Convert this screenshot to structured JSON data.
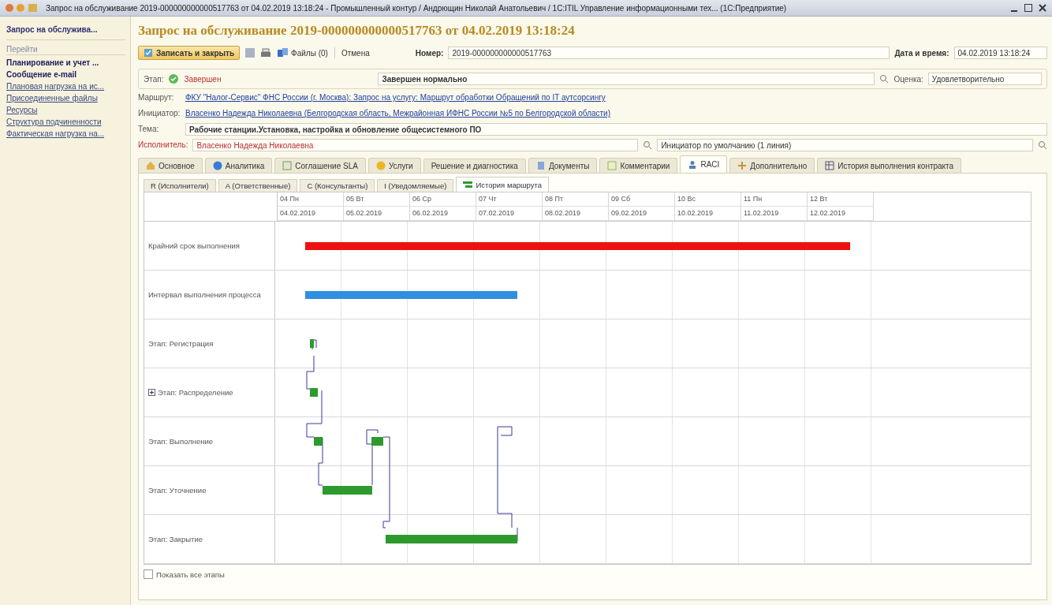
{
  "window": {
    "title": "Запрос на обслуживание 2019-000000000000517763 от 04.02.2019 13:18:24 - Промышленный контур / Андрющин Николай Анатольевич / 1С:ITIL Управление информационными тех... (1С:Предприятие)"
  },
  "sidebar": {
    "items": [
      {
        "label": "Запрос на обслужива...",
        "selected": true
      },
      {
        "label": "Перейти",
        "kind": "header"
      },
      {
        "label": "Планирование и учет ...",
        "kind": "bold"
      },
      {
        "label": "Сообщение e-mail",
        "kind": "bold"
      },
      {
        "label": "Плановая нагрузка на ис...",
        "kind": "link"
      },
      {
        "label": "Присоединенные файлы",
        "kind": "link"
      },
      {
        "label": "Ресурсы",
        "kind": "link"
      },
      {
        "label": "Структура подчиненности",
        "kind": "link"
      },
      {
        "label": "Фактическая нагрузка на...",
        "kind": "link"
      }
    ]
  },
  "form": {
    "title": "Запрос на обслуживание 2019-000000000000517763 от 04.02.2019 13:18:24",
    "toolbar": {
      "save_close": "Записать и закрыть",
      "files": "Файлы (0)",
      "cancel": "Отмена"
    },
    "number": {
      "label": "Номер:",
      "value": "2019-000000000000517763"
    },
    "datetime": {
      "label": "Дата и время:",
      "value": "04.02.2019 13:18:24"
    },
    "stage": {
      "label": "Этап:",
      "value": "Завершен",
      "result": "Завершен нормально"
    },
    "rating": {
      "label": "Оценка:",
      "value": "Удовлетворительно"
    },
    "route": {
      "label": "Маршрут:",
      "value": "ФКУ \"Налог-Сервис\" ФНС России (г. Москва): Запрос на услугу: Маршрут обработки Обращений по IT аутсорсингу"
    },
    "initiator": {
      "label": "Инициатор:",
      "value": "Власенко Надежда Николаевна (Белгородская область, Межрайонная ИФНС России №5 по Белгородской области)"
    },
    "subject": {
      "label": "Тема:",
      "value": "Рабочие станции.Установка, настройка и обновление общесистемного ПО"
    },
    "executor": {
      "label": "Исполнитель:",
      "value": "Власенко Надежда Николаевна",
      "group": "Инициатор по умолчанию (1 линия)"
    }
  },
  "tabs": [
    {
      "label": "Основное",
      "selected": false
    },
    {
      "label": "Аналитика",
      "selected": false
    },
    {
      "label": "Соглашение SLA",
      "selected": false
    },
    {
      "label": "Услуги",
      "selected": false
    },
    {
      "label": "Решение и диагностика",
      "selected": false
    },
    {
      "label": "Документы",
      "selected": false
    },
    {
      "label": "Комментарии",
      "selected": false
    },
    {
      "label": "RACI",
      "selected": true
    },
    {
      "label": "Дополнительно",
      "selected": false
    },
    {
      "label": "История выполнения контракта",
      "selected": false
    }
  ],
  "subtabs": [
    {
      "label": "R (Исполнители)",
      "selected": false
    },
    {
      "label": "A (Ответственные)",
      "selected": false
    },
    {
      "label": "C (Консультанты)",
      "selected": false
    },
    {
      "label": "I (Уведомляемые)",
      "selected": false
    },
    {
      "label": "История маршрута",
      "selected": true
    }
  ],
  "gantt": {
    "days": [
      {
        "weekday": "04 Пн",
        "date": "04.02.2019"
      },
      {
        "weekday": "05 Вт",
        "date": "05.02.2019"
      },
      {
        "weekday": "06 Ср",
        "date": "06.02.2019"
      },
      {
        "weekday": "07 Чт",
        "date": "07.02.2019"
      },
      {
        "weekday": "08 Пт",
        "date": "08.02.2019"
      },
      {
        "weekday": "09 Сб",
        "date": "09.02.2019"
      },
      {
        "weekday": "10 Вс",
        "date": "10.02.2019"
      },
      {
        "weekday": "11 Пн",
        "date": "11.02.2019"
      },
      {
        "weekday": "12 Вт",
        "date": "12.02.2019"
      }
    ],
    "rows": [
      {
        "label": "Крайний срок выполнения",
        "kind": "deadline",
        "collapsible": false
      },
      {
        "label": "Интервал выполнения процесса",
        "kind": "interval",
        "collapsible": false
      },
      {
        "label": "Этап: Регистрация",
        "kind": "stage",
        "collapsible": false
      },
      {
        "label": "Этап: Распределение",
        "kind": "stage",
        "collapsible": true
      },
      {
        "label": "Этап: Выполнение",
        "kind": "stage",
        "collapsible": false
      },
      {
        "label": "Этап: Уточнение",
        "kind": "stage",
        "collapsible": false
      },
      {
        "label": "Этап: Закрытие",
        "kind": "stage",
        "collapsible": false
      }
    ]
  },
  "show_all": {
    "label": "Показать все этапы",
    "checked": false
  }
}
